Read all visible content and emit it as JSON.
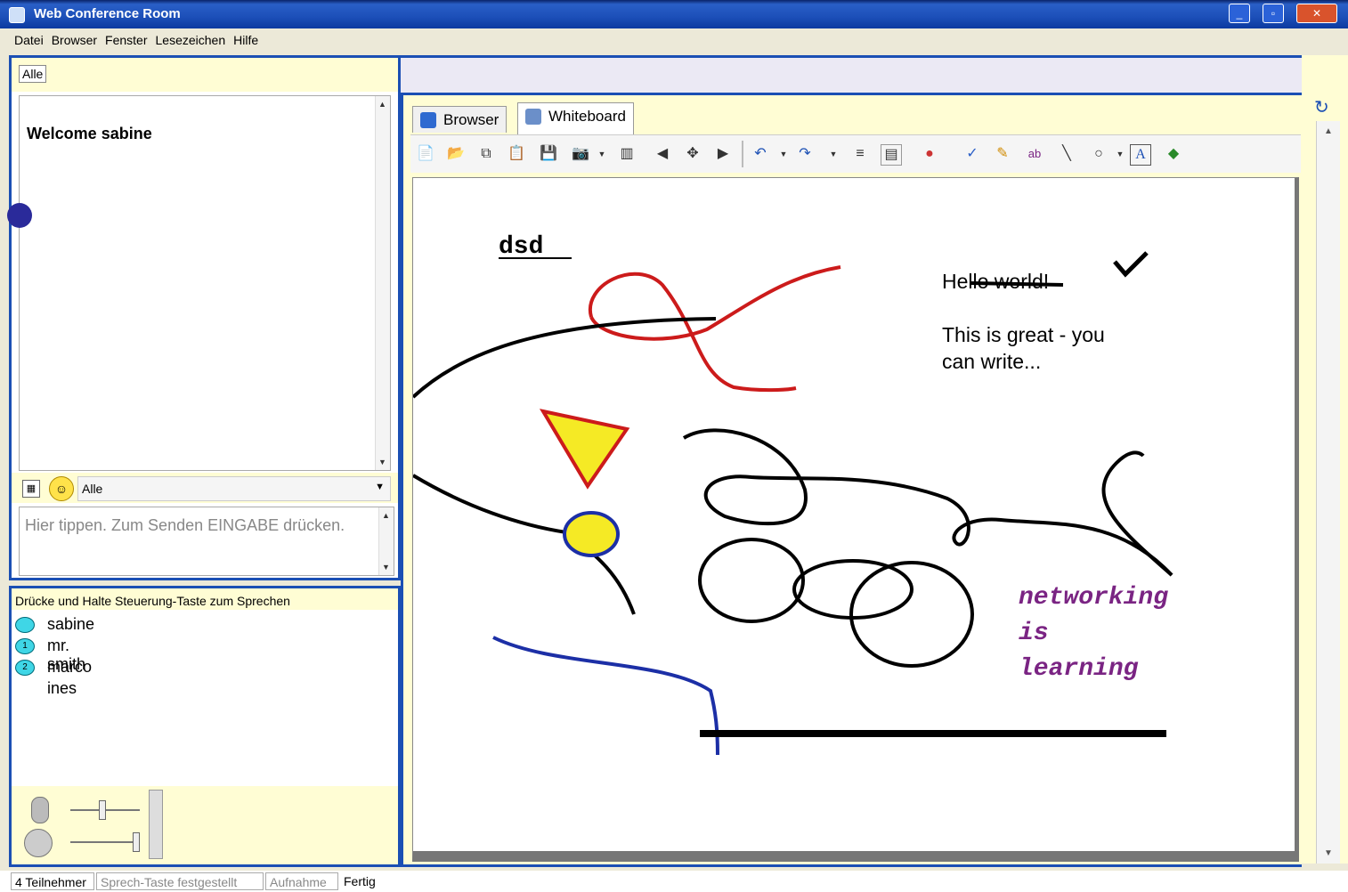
{
  "window": {
    "title": "Web Conference Room"
  },
  "menu": [
    "Datei",
    "Browser",
    "Fenster",
    "Lesezeichen",
    "Hilfe"
  ],
  "chat": {
    "tab_label": "Alle",
    "welcome": "Welcome sabine",
    "recipient": "Alle",
    "input_placeholder": "Hier tippen. Zum Senden EINGABE drücken."
  },
  "voice": {
    "hint": "Drücke und Halte Steuerung-Taste zum Sprechen",
    "participants": [
      {
        "name": "sabine",
        "badge": ""
      },
      {
        "name": "mr. smith",
        "badge": "1"
      },
      {
        "name": "marco",
        "badge": "2"
      },
      {
        "name": "ines",
        "badge": null
      }
    ]
  },
  "tabs": [
    {
      "label": "Browser",
      "active": false
    },
    {
      "label": "Whiteboard",
      "active": true
    }
  ],
  "whiteboard": {
    "text_heading": "dsd",
    "hello_prefix": "He",
    "hello_struck": "llo world",
    "hello_suffix": "!",
    "note_line1": "This is great - you",
    "note_line2": "can write...",
    "purple_line1": "networking",
    "purple_line2": "is",
    "purple_line3": "learning"
  },
  "status": {
    "participants": "4 Teilnehmer",
    "ptt": "Sprech-Taste festgestellt",
    "recording": "Aufnahme",
    "state": "Fertig"
  },
  "colors": {
    "frame_blue": "#1b4fb4",
    "panel_yellow": "#fffdd4",
    "red": "#cc1b1b",
    "yellow": "#f5ea25",
    "blue": "#1c2fa6",
    "purple": "#7a2483"
  },
  "icons": {
    "window_controls": [
      "minimize-icon",
      "maximize-icon",
      "close-icon"
    ],
    "voice_badges": "speech-bubble-icon"
  }
}
